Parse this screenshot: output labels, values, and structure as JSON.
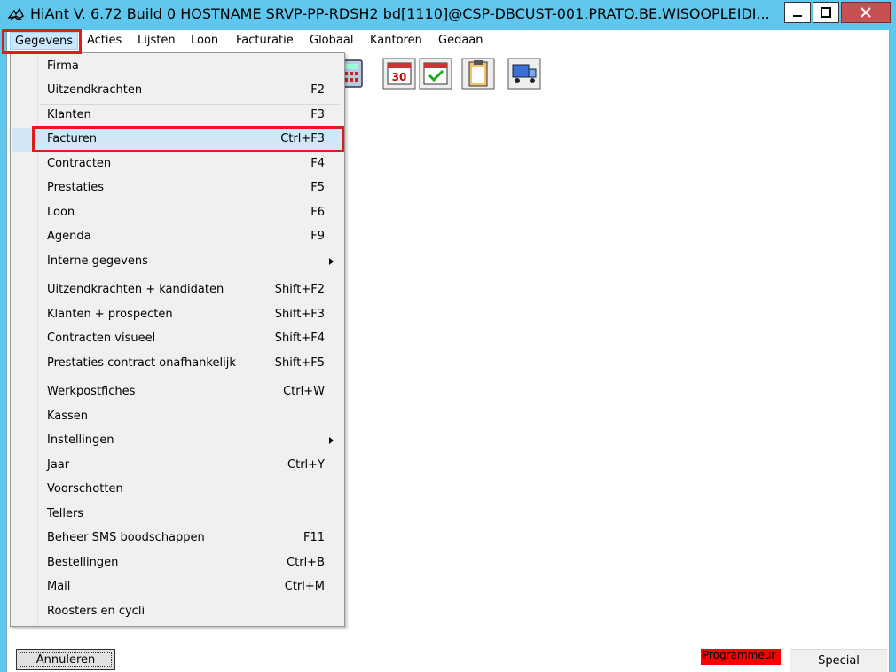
{
  "window": {
    "title": "HiAnt V. 6.72 Build 0 HOSTNAME SRVP-PP-RDSH2 bd[1110]@CSP-DBCUST-001.PRATO.BE.WISOOPLEIDI..."
  },
  "colors": {
    "titlebar": "#5fc7ee",
    "close": "#c75050",
    "highlight": "#e21a1a",
    "selected_row": "#d1e6f7",
    "badge": "#ff0000"
  },
  "menubar": {
    "items": [
      "Gegevens",
      "Acties",
      "Lijsten",
      "Loon",
      "Facturatie",
      "Globaal",
      "Kantoren",
      "Gedaan"
    ]
  },
  "dropdown": {
    "items": [
      {
        "label": "Firma",
        "shortcut": ""
      },
      {
        "label": "Uitzendkrachten",
        "shortcut": "F2"
      },
      {
        "label": "Klanten",
        "shortcut": "F3"
      },
      {
        "label": "Facturen",
        "shortcut": "Ctrl+F3"
      },
      {
        "label": "Contracten",
        "shortcut": "F4"
      },
      {
        "label": "Prestaties",
        "shortcut": "F5"
      },
      {
        "label": "Loon",
        "shortcut": "F6"
      },
      {
        "label": "Agenda",
        "shortcut": "F9"
      },
      {
        "label": "Interne gegevens",
        "shortcut": ""
      },
      {
        "label": "Uitzendkrachten + kandidaten",
        "shortcut": "Shift+F2"
      },
      {
        "label": "Klanten + prospecten",
        "shortcut": "Shift+F3"
      },
      {
        "label": "Contracten visueel",
        "shortcut": "Shift+F4"
      },
      {
        "label": "Prestaties contract onafhankelijk",
        "shortcut": "Shift+F5"
      },
      {
        "label": "Werkpostfiches",
        "shortcut": "Ctrl+W"
      },
      {
        "label": "Kassen",
        "shortcut": ""
      },
      {
        "label": "Instellingen",
        "shortcut": ""
      },
      {
        "label": "Jaar",
        "shortcut": "Ctrl+Y"
      },
      {
        "label": "Voorschotten",
        "shortcut": ""
      },
      {
        "label": "Tellers",
        "shortcut": ""
      },
      {
        "label": "Beheer SMS boodschappen",
        "shortcut": "F11"
      },
      {
        "label": "Bestellingen",
        "shortcut": "Ctrl+B"
      },
      {
        "label": "Mail",
        "shortcut": "Ctrl+M"
      },
      {
        "label": "Roosters en cycli",
        "shortcut": ""
      }
    ]
  },
  "toolbar_icons": [
    "calculator-icon",
    "calendar-30-icon",
    "calendar-check-icon",
    "clipboard-icon",
    "truck-icon"
  ],
  "footer": {
    "cancel_label": "Annuleren",
    "badge_label": "Programmeur",
    "special_label": "Special"
  }
}
